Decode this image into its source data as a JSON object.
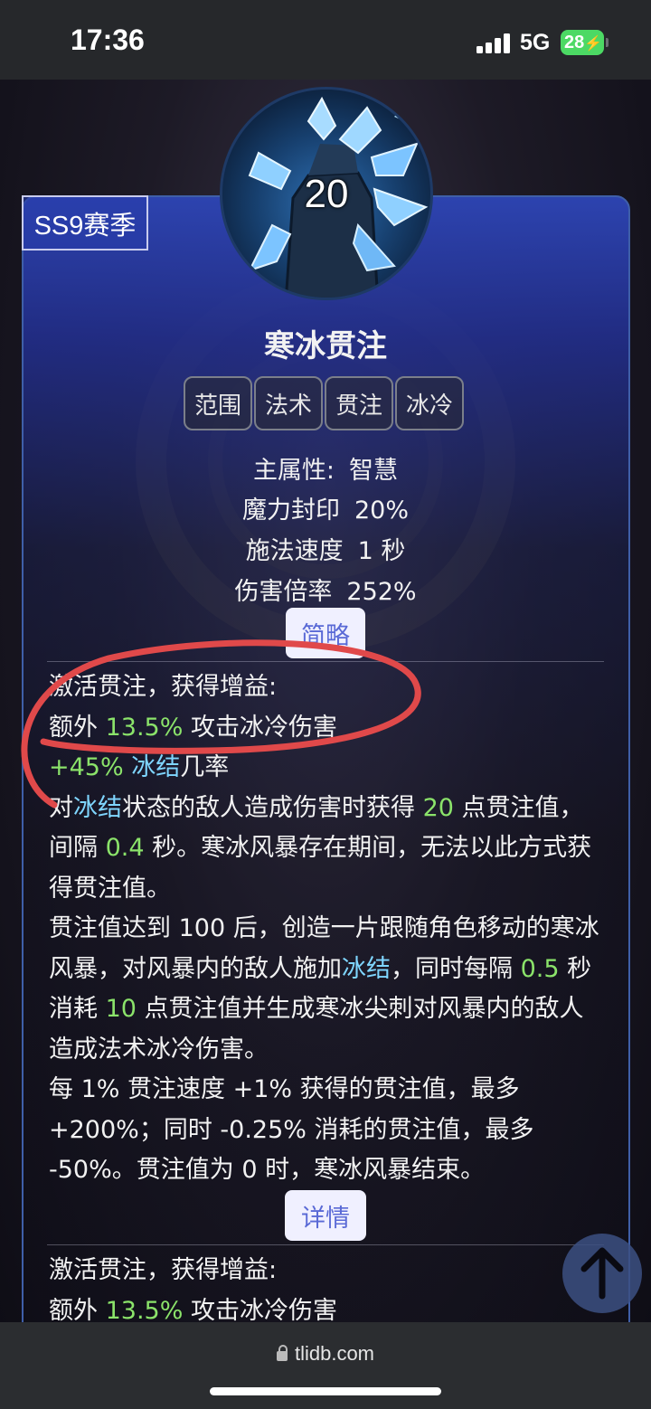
{
  "status_bar": {
    "time": "17:36",
    "network": "5G",
    "battery": "28"
  },
  "season_tag": "SS9赛季",
  "skill": {
    "level": "20",
    "name": "寒冰贯注",
    "tags": [
      "范围",
      "法术",
      "贯注",
      "冰冷"
    ],
    "attributes": [
      {
        "label": "主属性:",
        "value": "智慧"
      },
      {
        "label": "魔力封印",
        "value": "20%"
      },
      {
        "label": "施法速度",
        "value": "1 秒"
      },
      {
        "label": "伤害倍率",
        "value": "252%"
      }
    ]
  },
  "buttons": {
    "summary": "简略",
    "details": "详情"
  },
  "summary": {
    "line1": "激活贯注，获得增益:",
    "line2_pre": "额外 ",
    "line2_num": "13.5%",
    "line2_post": " 攻击冰冷伤害",
    "line3_num": "+45%",
    "line3_kw": "冰结",
    "line3_post": "几率",
    "p1_a": "对",
    "p1_kw": "冰结",
    "p1_b": "状态的敌人造成伤害时获得 ",
    "p1_num1": "20",
    "p1_c": " 点贯注值，间隔 ",
    "p1_num2": "0.4",
    "p1_d": " 秒。寒冰风暴存在期间，无法以此方式获得贯注值。",
    "p2_a": "贯注值达到 100 后，创造一片跟随角色移动的寒冰风暴，对风暴内的敌人施加",
    "p2_kw": "冰结",
    "p2_b": "，同时每隔 ",
    "p2_num1": "0.5",
    "p2_c": " 秒消耗 ",
    "p2_num2": "10",
    "p2_d": " 点贯注值并生成寒冰尖刺对风暴内的敌人造成法术冰冷伤害。",
    "p3": "每 1% 贯注速度 +1% 获得的贯注值，最多 +200%；同时 -0.25% 消耗的贯注值，最多 -50%。贯注值为 0 时，寒冰风暴结束。"
  },
  "details": {
    "line1": "激活贯注，获得增益:",
    "line2_pre": "额外 ",
    "line2_num": "13.5%",
    "line2_post": " 攻击冰冷伤害"
  },
  "browser": {
    "url": "tlidb.com"
  },
  "colors": {
    "number": "#8be36a",
    "keyword": "#7fd6ff",
    "annotation": "#e0494a",
    "card": "#2d44b2"
  }
}
